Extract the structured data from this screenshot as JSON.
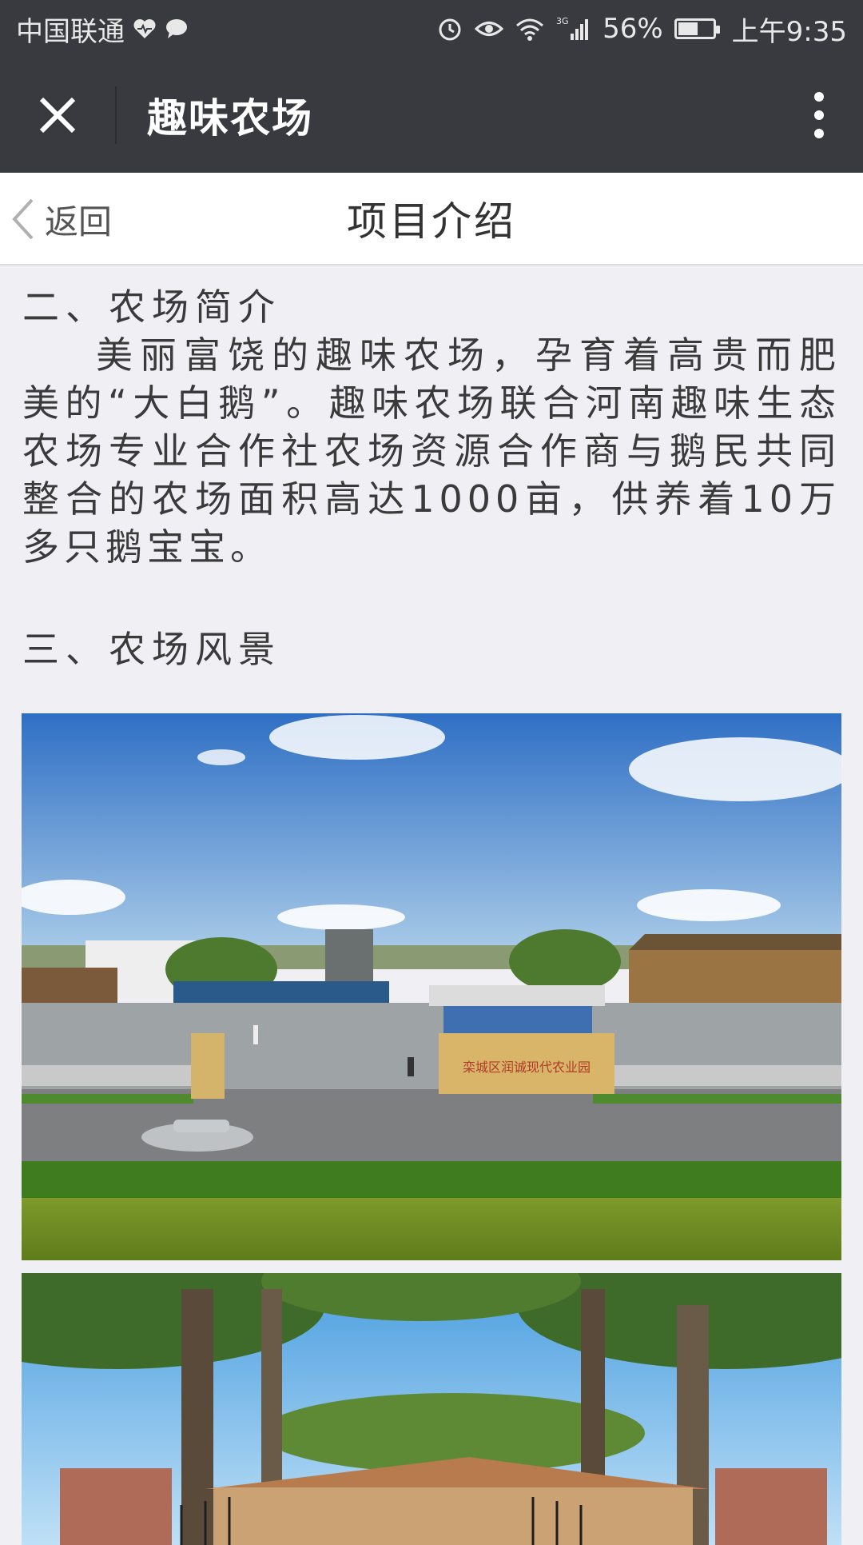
{
  "status_bar": {
    "carrier": "中国联通",
    "battery_percent": "56%",
    "battery_level": 0.56,
    "network": "3G",
    "time": "上午9:35",
    "icons": [
      "heart-icon",
      "chat-bubble-icon",
      "alarm-icon",
      "eye-icon",
      "wifi-icon",
      "signal-icon",
      "battery-icon"
    ]
  },
  "app_header": {
    "title": "趣味农场",
    "close_icon": "close-icon",
    "more_icon": "more-vertical-icon"
  },
  "page_nav": {
    "back_label": "返回",
    "title": "项目介绍"
  },
  "content": {
    "section_2": {
      "heading": "二、农场简介",
      "body": "美丽富饶的趣味农场，孕育着高贵而肥美的“大白鹅”。趣味农场联合河南趣味生态农场专业合作社农场资源合作商与鹅民共同整合的农场面积高达1000亩，供养着10万多只鹅宝宝。"
    },
    "section_3": {
      "heading": "三、农场风景",
      "photo_1_sign": "栾城区润诚现代农业园"
    }
  },
  "colors": {
    "header_bg": "#393a3f",
    "page_bg": "#efeff4",
    "text": "#3a3a3a"
  }
}
